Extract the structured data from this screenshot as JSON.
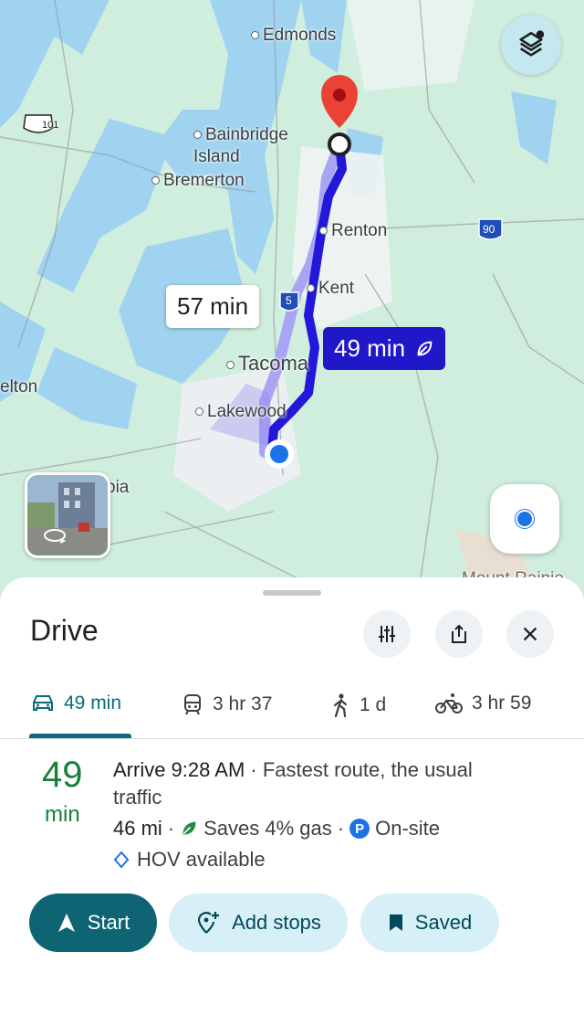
{
  "map": {
    "labels": {
      "edmonds": "Edmonds",
      "bainbridge": "Bainbridge\nIsland",
      "bremerton": "Bremerton",
      "renton": "Renton",
      "kent": "Kent",
      "tacoma": "Tacoma",
      "lakewood": "Lakewood",
      "elton": "elton",
      "olympia_partial": "pia",
      "mount_rainier_partial": "Mount Rainie",
      "hwy_101": "101",
      "hwy_90": "90",
      "hwy_5": "5"
    },
    "alt_route_time": "57 min",
    "main_route_time": "49 min",
    "colors": {
      "water": "#9fd3f0",
      "land": "#cfeedd",
      "route": "#2317d8",
      "alt_route": "#a9a5f5",
      "pin": "#ea4335"
    }
  },
  "sheet": {
    "title": "Drive",
    "icons": [
      "tune-icon",
      "share-icon",
      "close-icon"
    ]
  },
  "modes": [
    {
      "name": "drive",
      "icon": "car-icon",
      "label": "49 min",
      "selected": true
    },
    {
      "name": "transit",
      "icon": "train-icon",
      "label": "3 hr 37"
    },
    {
      "name": "walk",
      "icon": "walk-icon",
      "label": "1 d"
    },
    {
      "name": "bike",
      "icon": "bike-icon",
      "label": "3 hr 59"
    }
  ],
  "route": {
    "eta_number": "49",
    "eta_unit": "min",
    "arrive": "Arrive 9:28 AM",
    "summary": " · Fastest route, the usual traffic",
    "distance": "46 mi",
    "sep1": "·",
    "gas": "Saves 4% gas",
    "sep2": "·",
    "parking_badge": "P",
    "parking": "On-site",
    "hov": "HOV available"
  },
  "buttons": {
    "start": "Start",
    "add_stops": "Add stops",
    "saved": "Saved"
  }
}
